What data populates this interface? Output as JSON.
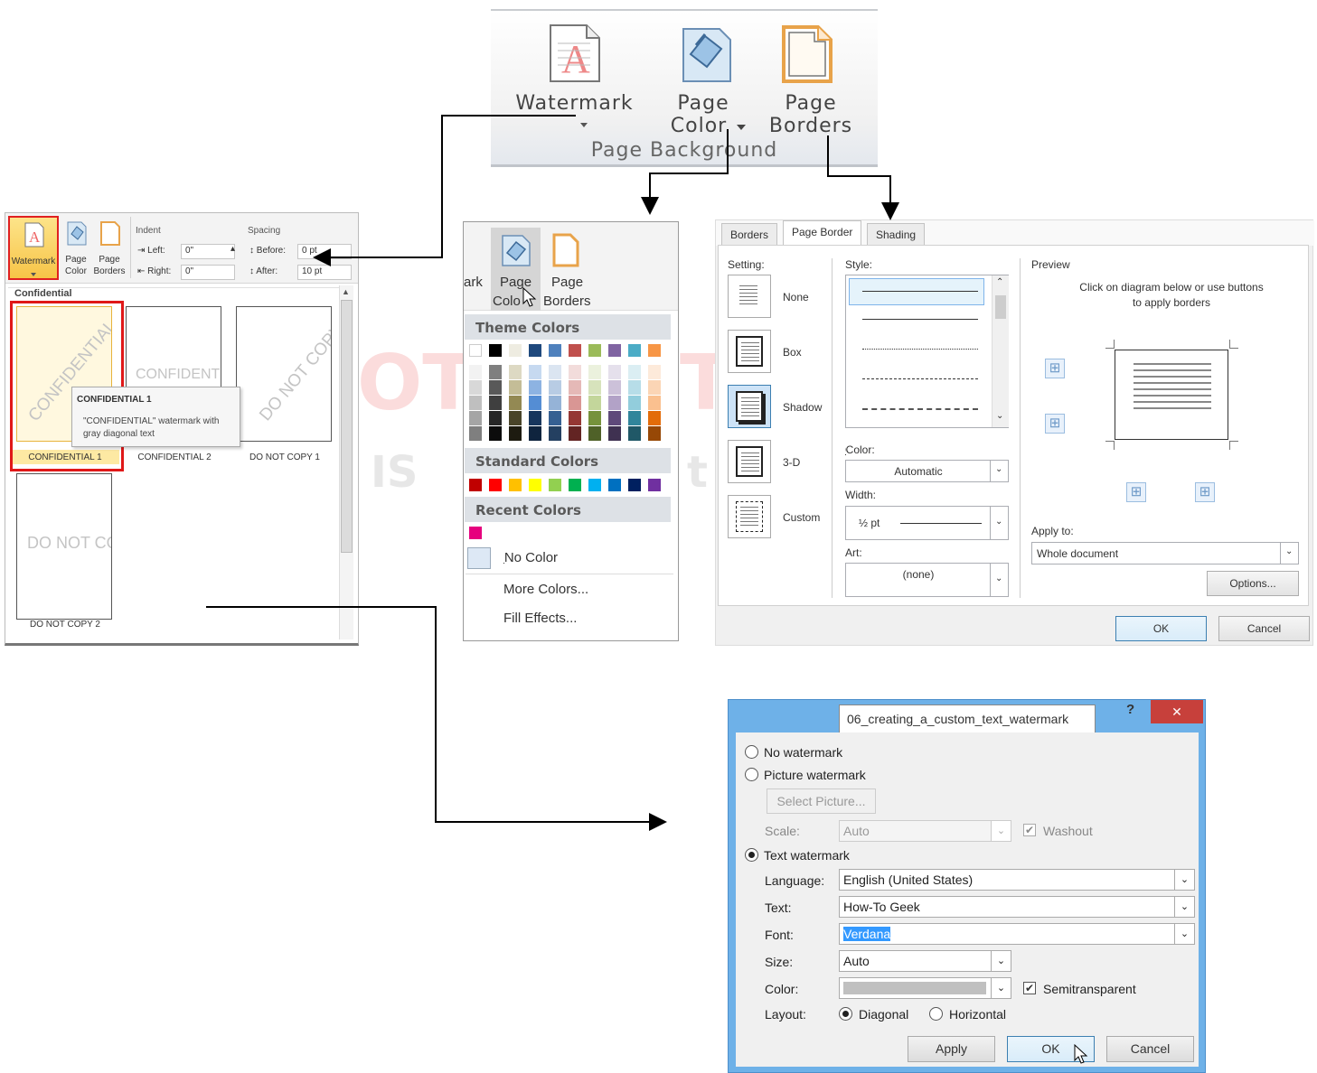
{
  "ribbon": {
    "watermark": "Watermark",
    "page_color_1": "Page",
    "page_color_2": "Color",
    "page_borders_1": "Page",
    "page_borders_2": "Borders",
    "group": "Page Background"
  },
  "gallery": {
    "watermark": "Watermark",
    "page_color": "Page Color",
    "page_color_1": "Page",
    "page_color_2": "Color",
    "page_borders_1": "Page",
    "page_borders_2": "Borders",
    "indent": "Indent",
    "left": "Left:",
    "left_val": "0\"",
    "right": "Right:",
    "right_val": "0\"",
    "spacing": "Spacing",
    "before": "Before:",
    "before_val": "0 pt",
    "after": "After:",
    "after_val": "10 pt",
    "section": "Confidential",
    "thumbs": [
      {
        "text": "CONFIDENTIAL",
        "label": "CONFIDENTIAL 1"
      },
      {
        "text": "CONFIDENTIAL",
        "label": "CONFIDENTIAL 2"
      },
      {
        "text": "DO NOT COPY",
        "label": "DO NOT COPY 1"
      },
      {
        "text": "DO NOT COPY",
        "label": "DO NOT COPY 2"
      }
    ],
    "tooltip_title": "CONFIDENTIAL 1",
    "tooltip_body": "\"CONFIDENTIAL\" watermark with gray diagonal text"
  },
  "color_panel": {
    "ark": "ark",
    "page1": "Page",
    "page2": "Colo",
    "borders1": "Page",
    "borders2": "Borders",
    "theme": "Theme Colors",
    "standard": "Standard Colors",
    "recent": "Recent Colors",
    "no_color": "No Color",
    "more": "More Colors...",
    "fill": "Fill Effects...",
    "theme_top": [
      "#ffffff",
      "#000000",
      "#eeece1",
      "#1f497d",
      "#4f81bd",
      "#c0504d",
      "#9bbb59",
      "#8064a2",
      "#4bacc6",
      "#f79646"
    ],
    "theme_cols": [
      [
        "#f2f2f2",
        "#d8d8d8",
        "#bfbfbf",
        "#a5a5a5",
        "#7f7f7f"
      ],
      [
        "#7f7f7f",
        "#595959",
        "#3f3f3f",
        "#262626",
        "#0c0c0c"
      ],
      [
        "#ddd9c3",
        "#c4bd97",
        "#938953",
        "#494429",
        "#1d1b10"
      ],
      [
        "#c6d9f0",
        "#8db3e2",
        "#548dd4",
        "#17365d",
        "#0f243e"
      ],
      [
        "#dbe5f1",
        "#b8cce4",
        "#95b3d7",
        "#366092",
        "#244061"
      ],
      [
        "#f2dcdb",
        "#e5b9b7",
        "#d99694",
        "#953734",
        "#632423"
      ],
      [
        "#ebf1dd",
        "#d7e3bc",
        "#c3d69b",
        "#76923c",
        "#4f6128"
      ],
      [
        "#e5e0ec",
        "#ccc1d9",
        "#b2a2c7",
        "#5f497a",
        "#3f3151"
      ],
      [
        "#dbeef3",
        "#b7dde8",
        "#92cddc",
        "#31859b",
        "#205867"
      ],
      [
        "#fdeada",
        "#fbd5b5",
        "#fac08f",
        "#e36c09",
        "#974806"
      ]
    ],
    "standard_swatches": [
      "#c00000",
      "#ff0000",
      "#ffc000",
      "#ffff00",
      "#92d050",
      "#00b050",
      "#00b0f0",
      "#0070c0",
      "#002060",
      "#7030a0"
    ],
    "recent_swatch": "#e6007e"
  },
  "borders_dialog": {
    "tabs": [
      "Borders",
      "Page Border",
      "Shading"
    ],
    "setting": "Setting:",
    "settings": [
      "None",
      "Box",
      "Shadow",
      "3-D",
      "Custom"
    ],
    "style": "Style:",
    "color": "Color:",
    "color_val": "Automatic",
    "width": "Width:",
    "width_val": "½ pt",
    "art": "Art:",
    "art_val": "(none)",
    "preview": "Preview",
    "preview_hint": "Click on diagram below or use buttons to apply borders",
    "apply_to": "Apply to:",
    "apply_val": "Whole document",
    "options": "Options...",
    "ok": "OK",
    "cancel": "Cancel"
  },
  "watermark_dialog": {
    "title": "06_creating_a_custom_text_watermark",
    "help": "?",
    "close": "✕",
    "no_watermark": "No watermark",
    "picture_watermark": "Picture watermark",
    "select_picture": "Select Picture...",
    "scale": "Scale:",
    "scale_val": "Auto",
    "washout": "Washout",
    "text_watermark": "Text watermark",
    "language": "Language:",
    "language_val": "English (United States)",
    "text": "Text:",
    "text_val": "How-To Geek",
    "font": "Font:",
    "font_val": "Verdana",
    "size": "Size:",
    "size_val": "Auto",
    "color": "Color:",
    "semitransparent": "Semitransparent",
    "layout": "Layout:",
    "diagonal": "Diagonal",
    "horizontal": "Horizontal",
    "apply": "Apply",
    "ok": "OK",
    "cancel": "Cancel"
  },
  "background_watermark": {
    "line1": "OT",
    "line2": "T",
    "line3": "IS",
    "line4": "t"
  }
}
